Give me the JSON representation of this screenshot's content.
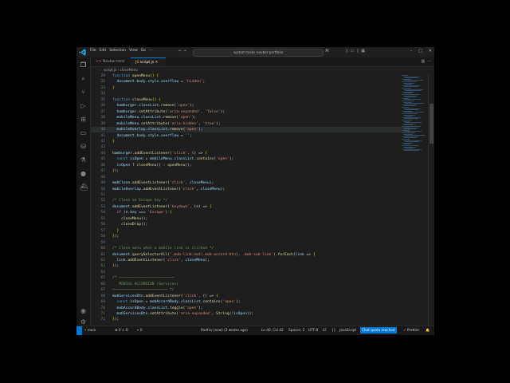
{
  "window": {
    "menu": [
      "File",
      "Edit",
      "Selection",
      "View",
      "Go",
      "···"
    ],
    "command_center": "system-tasks-navbar-portfolio",
    "nav_arrows": "← →"
  },
  "tabs": [
    {
      "label": "Navbar.html",
      "icon": "html-file-icon"
    },
    {
      "label": "script.js",
      "icon": "js-file-icon",
      "active": true
    }
  ],
  "breadcrumb": "script.js › closeMenu",
  "editor": {
    "lines": [
      {
        "n": "29",
        "html": "<span class='k'>function</span> <span class='f'>openMenu</span><span class='p'>()</span> <span class='p'>{</span>"
      },
      {
        "n": "32",
        "html": "  <span class='v'>document</span>.<span class='v'>body</span>.<span class='v'>style</span>.<span class='v'>overflow</span> = <span class='s'>'hidden'</span>;"
      },
      {
        "n": "33",
        "html": "<span class='p'>}</span>"
      },
      {
        "n": "34",
        "html": ""
      },
      {
        "n": "35",
        "html": "<span class='k'>function</span> <span class='f'>closeMenu</span><span class='p'>()</span> <span class='p'>{</span>"
      },
      {
        "n": "36",
        "html": "  <span class='v'>hamburger</span>.<span class='v'>classList</span>.<span class='f'>remove</span>(<span class='s'>'open'</span>);"
      },
      {
        "n": "37",
        "html": "  <span class='v'>hamburger</span>.<span class='f'>setAttribute</span>(<span class='s'>'aria-expanded'</span>, <span class='s'>'false'</span>);"
      },
      {
        "n": "38",
        "html": "  <span class='v'>mobileMenu</span>.<span class='v'>classList</span>.<span class='f'>remove</span>(<span class='s'>'open'</span>);"
      },
      {
        "n": "39",
        "html": "  <span class='v'>mobileMenu</span>.<span class='f'>setAttribute</span>(<span class='s'>'aria-hidden'</span>, <span class='s'>'true'</span>);"
      },
      {
        "n": "40",
        "html": "  <span class='v'>mobileOverlay</span>.<span class='v'>classList</span>.<span class='f'>remove</span>(<span class='s'>'open'</span>);",
        "hl": true
      },
      {
        "n": "41",
        "html": "  <span class='v'>document</span>.<span class='v'>body</span>.<span class='v'>style</span>.<span class='v'>overflow</span> = <span class='s'>''</span>;"
      },
      {
        "n": "42",
        "html": "<span class='p'>}</span>"
      },
      {
        "n": "43",
        "html": ""
      },
      {
        "n": "44",
        "html": "<span class='v'>hamburger</span>.<span class='f'>addEventListener</span>(<span class='s'>'click'</span>, () => <span class='p'>{</span>"
      },
      {
        "n": "45",
        "html": "  <span class='k'>const</span> <span class='v'>isOpen</span> = <span class='v'>mobileMenu</span>.<span class='v'>classList</span>.<span class='f'>contains</span>(<span class='s'>'open'</span>);"
      },
      {
        "n": "46",
        "html": "  <span class='v'>isOpen</span> ? <span class='f'>closeMenu</span>() : <span class='f'>openMenu</span>();"
      },
      {
        "n": "47",
        "html": "<span class='p'>}</span>);"
      },
      {
        "n": "48",
        "html": ""
      },
      {
        "n": "49",
        "html": "<span class='v'>mobClose</span>.<span class='f'>addEventListener</span>(<span class='s'>'click'</span>, <span class='v'>closeMenu</span>);"
      },
      {
        "n": "50",
        "html": "<span class='v'>mobileOverlay</span>.<span class='f'>addEventListener</span>(<span class='s'>'click'</span>, <span class='v'>closeMenu</span>);"
      },
      {
        "n": "51",
        "html": ""
      },
      {
        "n": "52",
        "html": "<span class='c'>/* Close on Escape key */</span>"
      },
      {
        "n": "53",
        "html": "<span class='v'>document</span>.<span class='f'>addEventListener</span>(<span class='s'>'keydown'</span>, (<span class='v'>e</span>) => <span class='p'>{</span>"
      },
      {
        "n": "54",
        "html": "  <span class='kc'>if</span> (<span class='v'>e</span>.<span class='v'>key</span> === <span class='s'>'Escape'</span>) <span class='p'>{</span>"
      },
      {
        "n": "55",
        "html": "    <span class='f'>closeMenu</span>();"
      },
      {
        "n": "56",
        "html": "    <span class='f'>closeDrop</span>();"
      },
      {
        "n": "57",
        "html": "  <span class='p'>}</span>"
      },
      {
        "n": "58",
        "html": "<span class='p'>}</span>);"
      },
      {
        "n": "59",
        "html": ""
      },
      {
        "n": "60",
        "html": "<span class='c'>/* Close menu when a mobile link is clicked */</span>"
      },
      {
        "n": "61",
        "html": "<span class='v'>document</span>.<span class='f'>querySelectorAll</span>(<span class='s'>'.mob-link:not(.mob-accord-btn), .mob-sub-link'</span>).<span class='f'>forEach</span>(<span class='v'>link</span> => <span class='p'>{</span>"
      },
      {
        "n": "62",
        "html": "  <span class='v'>link</span>.<span class='f'>addEventListener</span>(<span class='s'>'click'</span>, <span class='v'>closeMenu</span>);"
      },
      {
        "n": "63",
        "html": "<span class='p'>}</span>);"
      },
      {
        "n": "64",
        "html": ""
      },
      {
        "n": "65",
        "html": "<span class='c'>/* ─────────────────────────</span>"
      },
      {
        "n": "66",
        "html": "<span class='c'>   MOBILE ACCORDION (Services)</span>"
      },
      {
        "n": "67",
        "html": "<span class='c'>───────────────────────── */</span>"
      },
      {
        "n": "68",
        "html": "<span class='v'>mobServicesBtn</span>.<span class='f'>addEventListener</span>(<span class='s'>'click'</span>, () => <span class='p'>{</span>"
      },
      {
        "n": "69",
        "html": "  <span class='k'>const</span> <span class='v'>isOpen</span> = <span class='v'>mobAccordBody</span>.<span class='v'>classList</span>.<span class='f'>contains</span>(<span class='s'>'open'</span>);"
      },
      {
        "n": "70",
        "html": "  <span class='v'>mobAccordBody</span>.<span class='v'>classList</span>.<span class='f'>toggle</span>(<span class='s'>'open'</span>);"
      },
      {
        "n": "71",
        "html": "  <span class='v'>mobServicesBtn</span>.<span class='f'>setAttribute</span>(<span class='s'>'aria-expanded'</span>, <span class='f'>String</span>(!<span class='v'>isOpen</span>));"
      },
      {
        "n": "72",
        "html": "<span class='p'>}</span>);"
      }
    ]
  },
  "status": {
    "branch": "main",
    "problems": "⊗ 0 ⚠ 0",
    "ports": "⑂ 0",
    "git_blame": "Parthiv (now) (2 weeks ago)",
    "position": "Ln 40, Col 42",
    "spaces": "Spaces: 2",
    "encoding": "UTF-8",
    "eol": "LF",
    "braces": "{}",
    "language": "JavaScript",
    "chat": "Chat quota reached",
    "prettier": "✓ Prettier",
    "bell": "🔔"
  }
}
